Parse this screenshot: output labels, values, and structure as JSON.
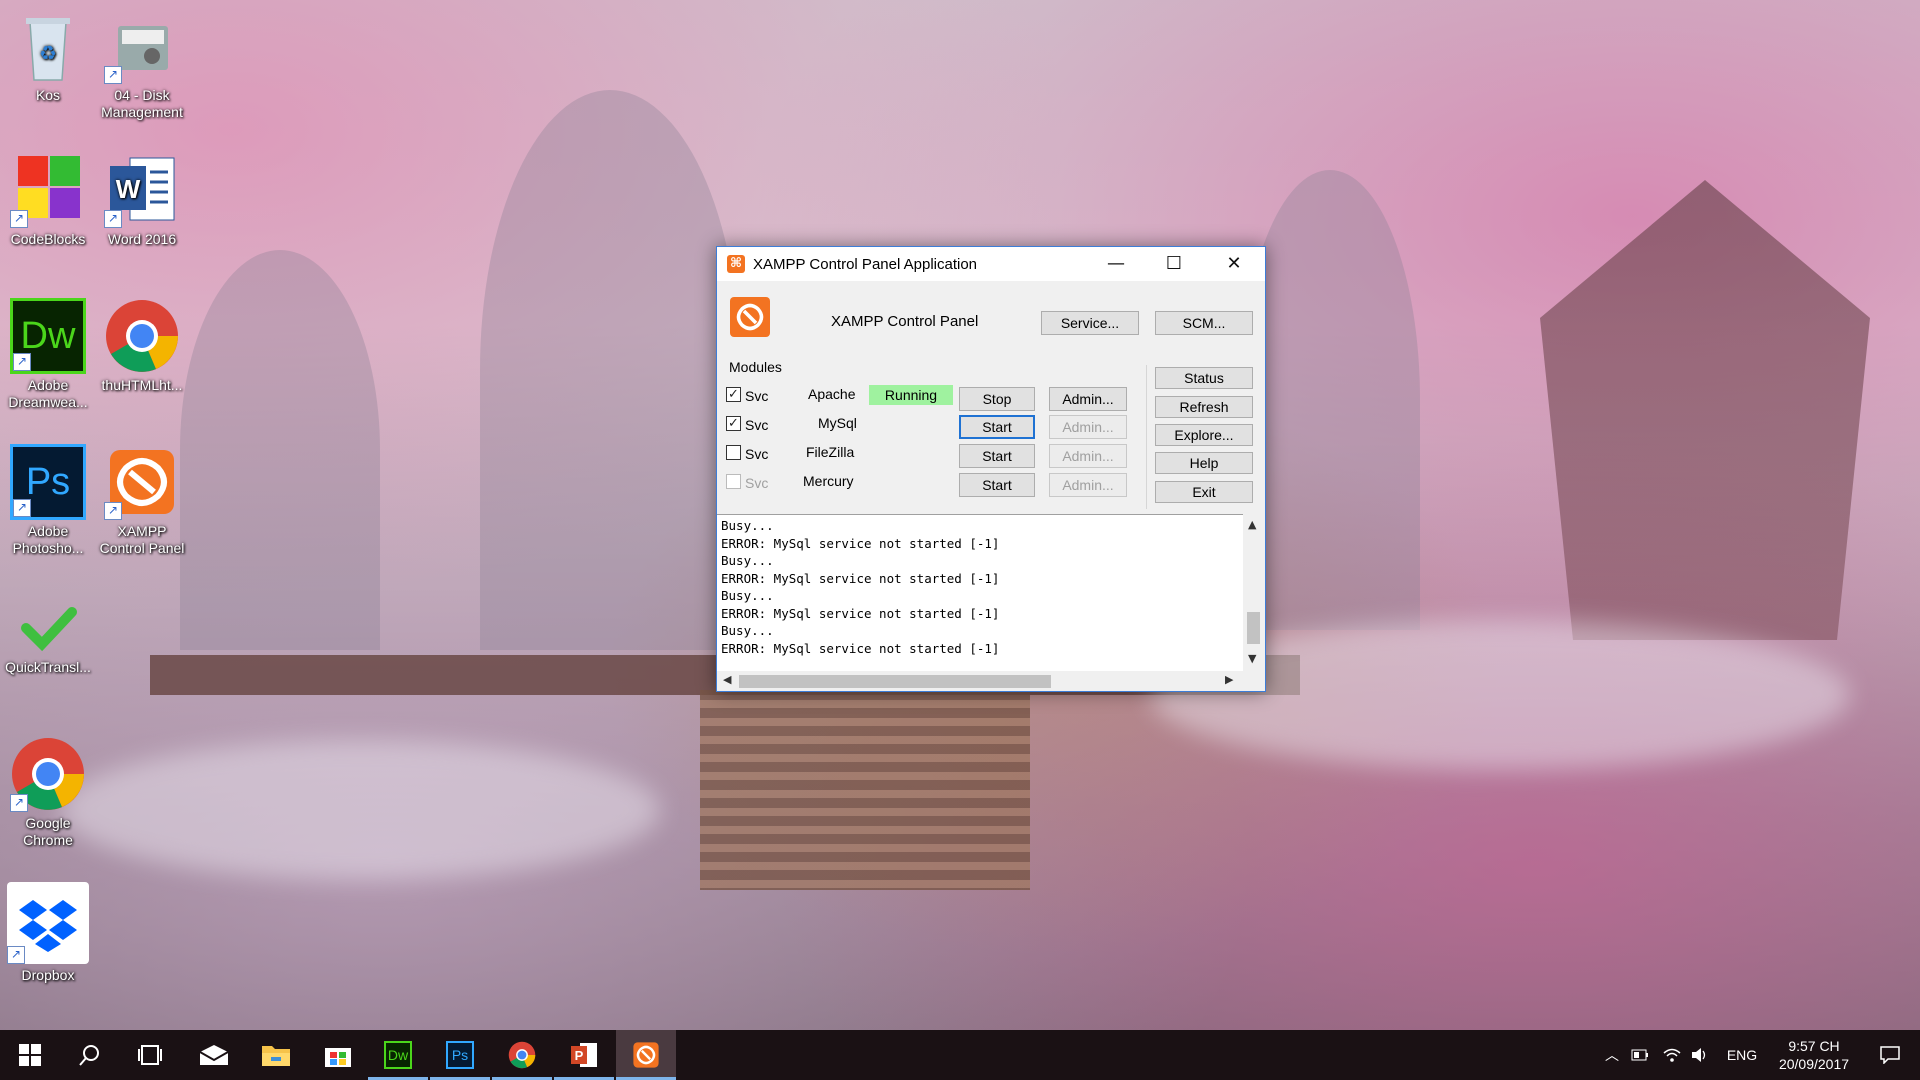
{
  "desktop_icons": [
    {
      "label": "Kos",
      "icon": "recycle-bin-icon"
    },
    {
      "label": "04 - Disk Management",
      "icon": "disk-management-icon"
    },
    {
      "label": "CodeBlocks",
      "icon": "codeblocks-icon"
    },
    {
      "label": "Word 2016",
      "icon": "word-icon"
    },
    {
      "label": "Adobe Dreamwea...",
      "icon": "dreamweaver-icon",
      "text": "Dw"
    },
    {
      "label": "thuHTMLht...",
      "icon": "chrome-icon"
    },
    {
      "label": "Adobe Photosho...",
      "icon": "photoshop-icon",
      "text": "Ps"
    },
    {
      "label": "XAMPP Control Panel",
      "icon": "xampp-icon"
    },
    {
      "label": "QuickTransl...",
      "icon": "checkmark-icon"
    },
    {
      "label": "Google Chrome",
      "icon": "chrome-icon"
    },
    {
      "label": "Dropbox",
      "icon": "dropbox-icon"
    }
  ],
  "window": {
    "title": "XAMPP Control Panel Application",
    "header": "XAMPP Control Panel",
    "service_button": "Service...",
    "scm_button": "SCM...",
    "modules_label": "Modules",
    "svc_label": "Svc",
    "modules": [
      {
        "name": "Apache",
        "svc_checked": true,
        "svc_enabled": true,
        "status": "Running",
        "action": "Stop",
        "admin": "Admin...",
        "admin_enabled": true
      },
      {
        "name": "MySql",
        "svc_checked": true,
        "svc_enabled": true,
        "status": "",
        "action": "Start",
        "admin": "Admin...",
        "admin_enabled": false
      },
      {
        "name": "FileZilla",
        "svc_checked": false,
        "svc_enabled": true,
        "status": "",
        "action": "Start",
        "admin": "Admin...",
        "admin_enabled": false
      },
      {
        "name": "Mercury",
        "svc_checked": false,
        "svc_enabled": false,
        "status": "",
        "action": "Start",
        "admin": "Admin...",
        "admin_enabled": false
      }
    ],
    "side_buttons": {
      "status": "Status",
      "refresh": "Refresh",
      "explore": "Explore...",
      "help": "Help",
      "exit": "Exit"
    },
    "log_lines": [
      "Busy...",
      "ERROR: MySql service not started [-1]",
      "Busy...",
      "ERROR: MySql service not started [-1]",
      "Busy...",
      "ERROR: MySql service not started [-1]",
      "Busy...",
      "ERROR: MySql service not started [-1]"
    ]
  },
  "taskbar": {
    "language": "ENG",
    "time": "9:57 CH",
    "date": "20/09/2017",
    "apps": [
      "start",
      "search",
      "task-view",
      "mail",
      "file-explorer",
      "store",
      "dreamweaver",
      "photoshop",
      "chrome",
      "powerpoint",
      "xampp"
    ],
    "dw_text": "Dw",
    "ps_text": "Ps"
  },
  "colors": {
    "running_bg": "#9ff29f",
    "xampp_orange": "#f37321",
    "window_border": "#3c7dd8"
  }
}
